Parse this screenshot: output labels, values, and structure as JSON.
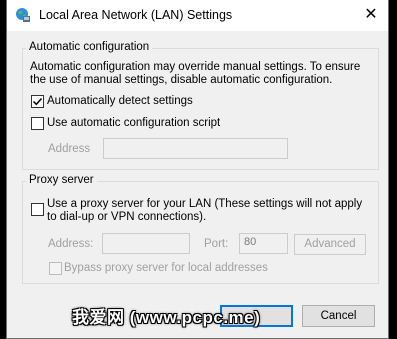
{
  "window": {
    "title": "Local Area Network (LAN) Settings",
    "close_glyph": "✕"
  },
  "auto_config": {
    "legend": "Automatic configuration",
    "description": "Automatic configuration may override manual settings.  To ensure the use of manual settings, disable automatic configuration.",
    "detect_label": "Automatically detect settings",
    "detect_checked": true,
    "script_label": "Use automatic configuration script",
    "script_checked": false,
    "address_label": "Address",
    "address_value": ""
  },
  "proxy": {
    "legend": "Proxy server",
    "use_proxy_label": "Use a proxy server for your LAN (These settings will not apply to dial-up or VPN connections).",
    "use_proxy_checked": false,
    "address_label": "Address:",
    "address_value": "",
    "port_label": "Port:",
    "port_value": "80",
    "advanced_label": "Advanced",
    "bypass_label": "Bypass proxy server for local addresses",
    "bypass_checked": false
  },
  "footer": {
    "ok_label": "",
    "cancel_label": "Cancel"
  },
  "watermark": "我爱网 (www.pcpc.me)",
  "colors": {
    "accent": "#0078d7",
    "dialog_bg": "#f0f0f0",
    "disabled_text": "#a0a0a0"
  }
}
